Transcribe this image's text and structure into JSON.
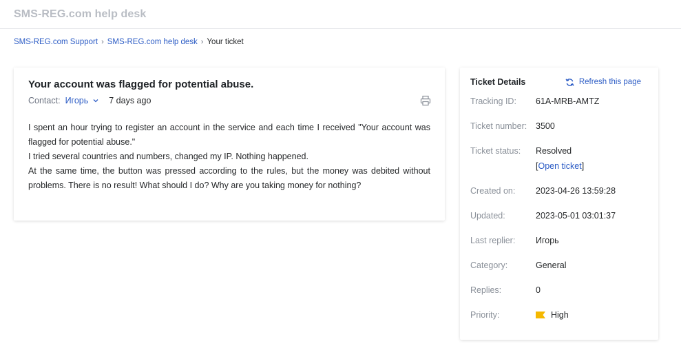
{
  "header": {
    "brand": "SMS-REG.com help desk"
  },
  "breadcrumb": {
    "items": [
      "SMS-REG.com Support",
      "SMS-REG.com help desk"
    ],
    "sep": "›",
    "current": "Your ticket"
  },
  "ticket": {
    "title": "Your account was flagged for potential abuse.",
    "contact_label": "Contact:",
    "contact_name": "Игорь",
    "time_ago": "7 days ago",
    "body": [
      "I spent an hour trying to register an account in the service and each time I received \"Your account was flagged for potential abuse.\"",
      "I tried several countries and numbers, changed my IP. Nothing happened.",
      "At the same time, the button was pressed according to the rules, but the money was debited without problems. There is no result! What should I do? Why are you taking money for nothing?"
    ]
  },
  "details": {
    "title": "Ticket Details",
    "refresh_label": "Refresh this page",
    "tracking_id_label": "Tracking ID:",
    "tracking_id": "61A-MRB-AMTZ",
    "ticket_number_label": "Ticket number:",
    "ticket_number": "3500",
    "status_label": "Ticket status:",
    "status": "Resolved",
    "open_ticket_label": "Open ticket",
    "bracket_open": "[",
    "bracket_close": "]",
    "created_label": "Created on:",
    "created": "2023-04-26 13:59:28",
    "updated_label": "Updated:",
    "updated": "2023-05-01 03:01:37",
    "last_replier_label": "Last replier:",
    "last_replier": "Игорь",
    "category_label": "Category:",
    "category": "General",
    "replies_label": "Replies:",
    "replies": "0",
    "priority_label": "Priority:",
    "priority": "High"
  },
  "colors": {
    "accent": "#2c5cc5",
    "priority_high": "#f5b800",
    "brand_muted": "#b9bdc4"
  },
  "icons": {
    "print": "printer-icon",
    "refresh": "refresh-icon",
    "contact_dropdown": "chevron-down-icon",
    "priority": "flag-icon"
  }
}
